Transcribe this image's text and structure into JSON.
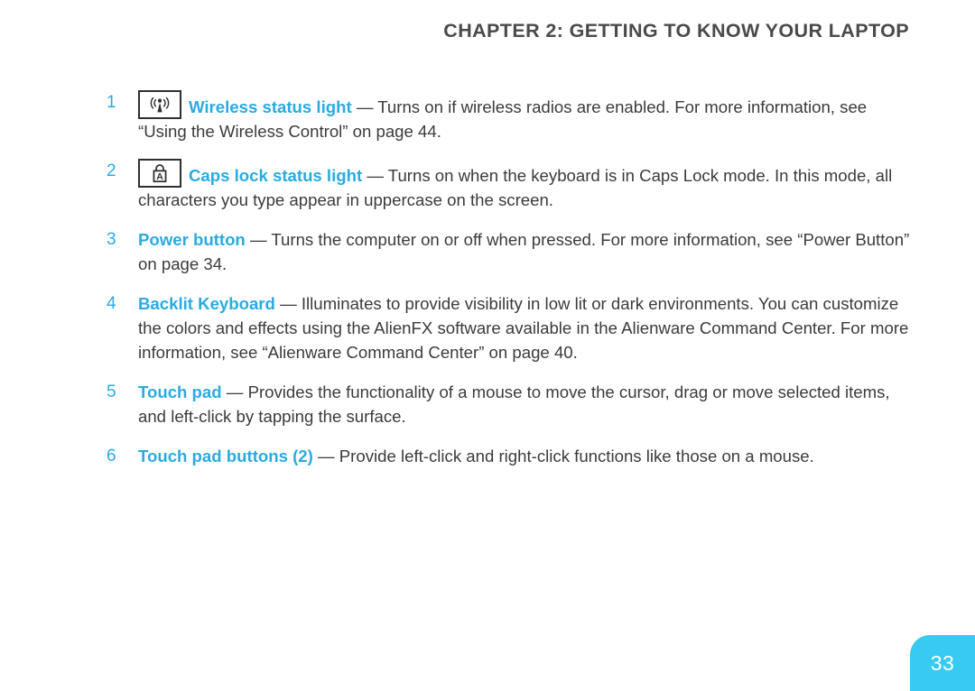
{
  "header": {
    "title": "CHAPTER 2: GETTING TO KNOW YOUR LAPTOP"
  },
  "colors": {
    "accent_cyan": "#29ABE2",
    "badge_cyan": "#37CAF3",
    "body_text": "#3b3b3b",
    "header_text": "#4a4a4a",
    "page_background": "#ffffff"
  },
  "items": [
    {
      "number": "1",
      "icon": "wireless-status-icon",
      "label": "Wireless status light",
      "dash": " — ",
      "description": "Turns on if wireless radios are enabled. For more information, see “Using the Wireless Control” on page 44."
    },
    {
      "number": "2",
      "icon": "caps-lock-status-icon",
      "label": "Caps lock status light",
      "dash": " — ",
      "description": "Turns on when the keyboard is in Caps Lock mode. In this mode, all characters you type appear in uppercase on the screen."
    },
    {
      "number": "3",
      "icon": null,
      "label": "Power button",
      "dash": " — ",
      "description": "Turns the computer on or off when pressed. For more information, see “Power Button” on page 34."
    },
    {
      "number": "4",
      "icon": null,
      "label": "Backlit Keyboard",
      "dash": " —  ",
      "description": "Illuminates to provide visibility in low lit or dark environments. You can customize the colors and effects using the AlienFX software available in the Alienware Command Center. For more information, see “Alienware Command Center” on page 40."
    },
    {
      "number": "5",
      "icon": null,
      "label": "Touch pad",
      "dash": " — ",
      "description": "Provides the functionality of a mouse to move the cursor, drag or move selected items, and left-click by tapping the surface."
    },
    {
      "number": "6",
      "icon": null,
      "label": "Touch pad buttons (2)",
      "dash": " — ",
      "description": "Provide left-click and right-click functions like those on a mouse."
    }
  ],
  "footer": {
    "page_number": "33"
  }
}
